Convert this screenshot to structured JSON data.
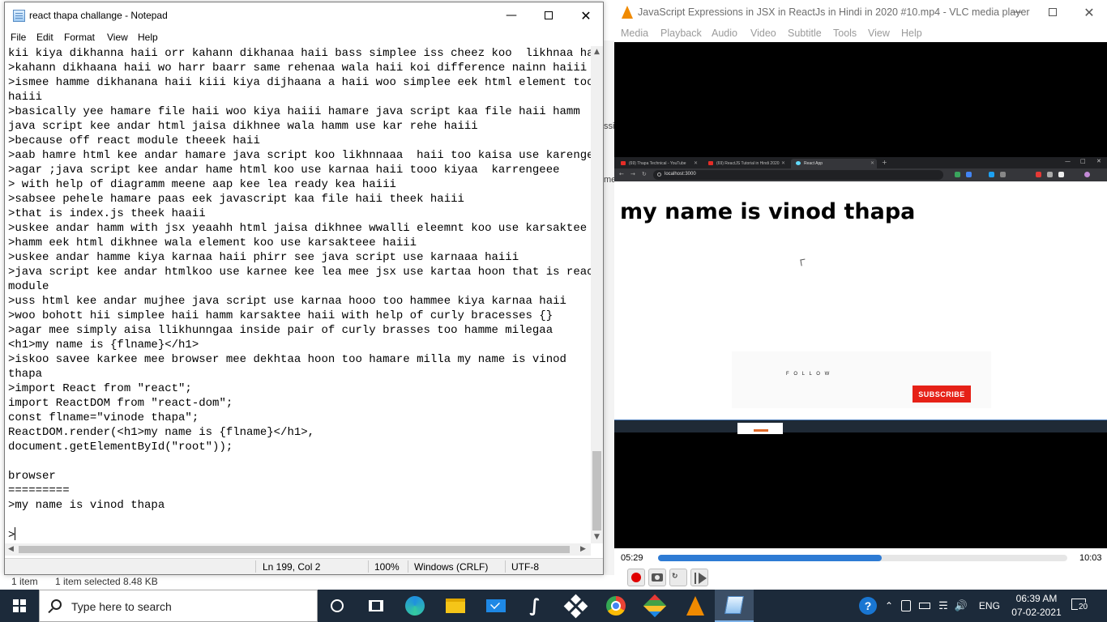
{
  "explorer": {
    "status_items": "1 item",
    "status_selected": "1 item selected  8.48 KB",
    "right_fragments": [
      "ssi",
      "me"
    ]
  },
  "notepad": {
    "title": "react thapa challange - Notepad",
    "menu": [
      "File",
      "Edit",
      "Format",
      "View",
      "Help"
    ],
    "text_lines": [
      "kii kiya dikhanna haii orr kahann dikhanaa haii bass simplee iss cheez koo  likhnaa hai",
      ">kahann dikhaana haii wo harr baarr same rehenaa wala haii koi difference nainn haiii",
      ">ismee hamme dikhanana haii kiii kiya dijhaana a haii woo simplee eek html element too",
      "haiii",
      ">basically yee hamare file haii woo kiya haiii hamare java script kaa file haii hamm",
      "java script kee andar html jaisa dikhnee wala hamm use kar rehe haiii",
      ">because off react module theeek haii",
      ">aab hamre html kee andar hamare java script koo likhnnaaa  haii too kaisa use karengee",
      ">agar ;java script kee andar hame html koo use karnaa haii tooo kiyaa  karrengeee",
      "> with help of diagramm meene aap kee lea ready kea haiii",
      ">sabsee pehele hamare paas eek javascript kaa file haii theek haiii",
      ">that is index.js theek haaii",
      ">uskee andar hamm with jsx yeaahh html jaisa dikhnee wwalli eleemnt koo use karsaktee hai.",
      ">hamm eek html dikhnee wala element koo use karsakteee haiii",
      ">uskee andar hamme kiya karnaa haii phirr see java script use karnaaa haiii",
      ">java script kee andar htmlkoo use karnee kee lea mee jsx use kartaa hoon that is react",
      "module",
      ">uss html kee andar mujhee java script use karnaa hooo too hammee kiya karnaa haii",
      ">woo bohott hii simplee haii hamm karsaktee haii with help of curly bracesses {}",
      ">agar mee simply aisa llikhunngaa inside pair of curly brasses too hamme milegaa",
      "<h1>my name is {flname}</h1>",
      ">iskoo savee karkee mee browser mee dekhtaa hoon too hamare milla my name is vinod",
      "thapa",
      ">import React from \"react\";",
      "import ReactDOM from \"react-dom\";",
      "const flname=\"vinode thapa\";",
      "ReactDOM.render(<h1>my name is {flname}</h1>,",
      "document.getElementById(\"root\"));",
      "",
      "browser",
      "=========",
      ">my name is vinod thapa",
      "",
      ">"
    ],
    "status": {
      "position": "Ln 199, Col 2",
      "zoom": "100%",
      "line_ending": "Windows (CRLF)",
      "encoding": "UTF-8"
    }
  },
  "vlc": {
    "title": "JavaScript Expressions in JSX in ReactJs in Hindi in 2020 #10.mp4 - VLC media player",
    "menu": [
      "Media",
      "Playback",
      "Audio",
      "Video",
      "Subtitle",
      "Tools",
      "View",
      "Help"
    ],
    "elapsed": "05:29",
    "total": "10:03",
    "progress": 0.546,
    "video": {
      "tabs": [
        {
          "label": "(69) Thapa Technical - YouTube"
        },
        {
          "label": "(69) ReactJS Tutorial in Hindi 2020"
        },
        {
          "label": "React App"
        }
      ],
      "address": "localhost:3000",
      "heading": "my name is vinod thapa",
      "banner_text": "F O L L O W",
      "subscribe_label": "SUBSCRIBE"
    }
  },
  "taskbar": {
    "search_placeholder": "Type here to search",
    "language": "ENG",
    "time": "06:39 AM",
    "date": "07-02-2021",
    "notification_count": "20",
    "apps": [
      "cortana-icon",
      "task-view-icon",
      "edge-icon",
      "file-explorer-icon",
      "mail-icon",
      "winscp-icon",
      "dropbox-icon",
      "chrome-icon",
      "git-icon",
      "vlc-icon",
      "notepad-icon"
    ]
  },
  "colors": {
    "taskbar_bg": "#1c2a3a",
    "vlc_accent": "#2e7bd4",
    "subscribe_red": "#e62117",
    "vlc_orange": "#f08a00"
  }
}
